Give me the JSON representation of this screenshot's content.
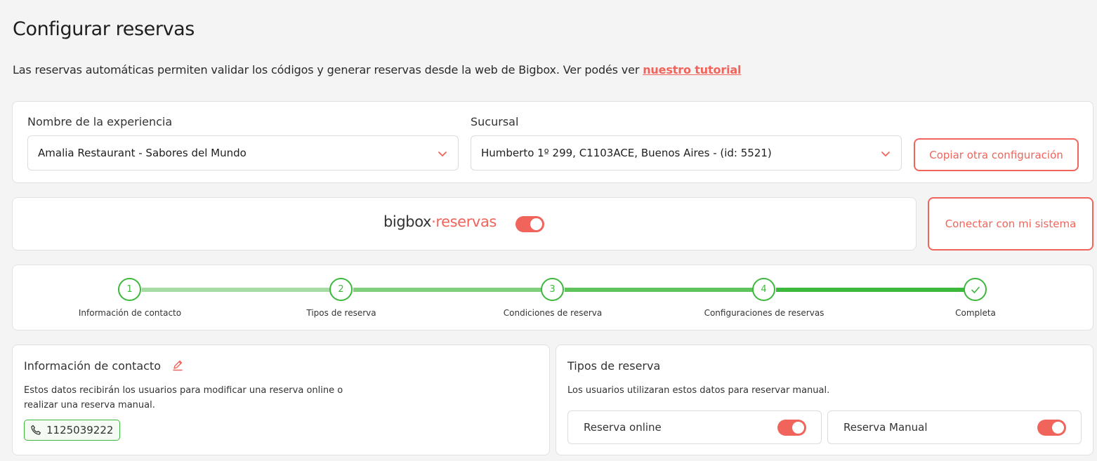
{
  "page": {
    "title": "Configurar reservas",
    "intro_text": "Las reservas automáticas permiten validar los códigos y generar reservas desde la web de Bigbox. Ver podés ver ",
    "intro_link": "nuestro tutorial"
  },
  "selectors": {
    "experience_label": "Nombre de la experiencia",
    "experience_value": "Amalia Restaurant - Sabores del Mundo",
    "branch_label": "Sucursal",
    "branch_value": "Humberto 1º 299, C1103ACE, Buenos Aires - (id: 5521)",
    "copy_button": "Copiar otra configuración"
  },
  "brand": {
    "part1": "bigbox",
    "separator": "·",
    "part2": "reservas",
    "toggle_on": true,
    "connect_button": "Conectar con mi sistema"
  },
  "steps": [
    {
      "number": "1",
      "label": "Información de contacto"
    },
    {
      "number": "2",
      "label": "Tipos de reserva"
    },
    {
      "number": "3",
      "label": "Condiciones de reserva"
    },
    {
      "number": "4",
      "label": "Configuraciones de reservas"
    },
    {
      "number": "✓",
      "label": "Completa"
    }
  ],
  "contact": {
    "title": "Información de contacto",
    "description_line1": "Estos datos recibirán los usuarios para modificar una reserva online o",
    "description_line2": "realizar una reserva manual.",
    "phone": "1125039222"
  },
  "types": {
    "title": "Tipos de reserva",
    "description": "Los usuarios utilizaran estos datos para reservar manual.",
    "options": [
      {
        "label": "Reserva online",
        "enabled": true
      },
      {
        "label": "Reserva Manual",
        "enabled": true
      }
    ]
  },
  "colors": {
    "accent": "#f0645b",
    "success": "#3cb83c",
    "background": "#f4f4f4"
  },
  "icons": {
    "select_chevron": "chevron-down-icon",
    "edit": "pencil-icon",
    "phone": "phone-icon",
    "complete": "check-icon"
  }
}
